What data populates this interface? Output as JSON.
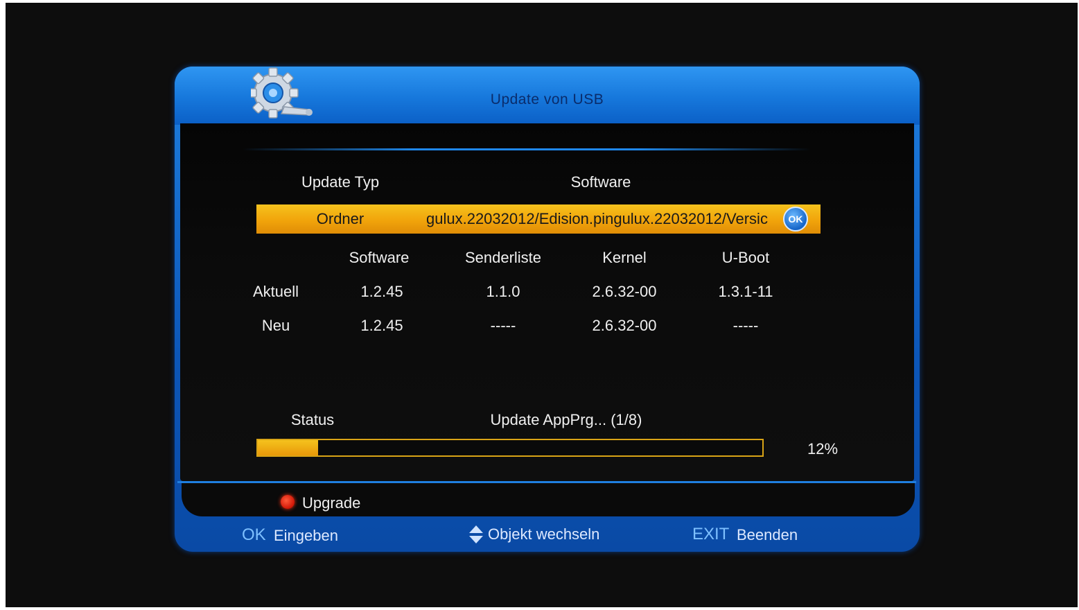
{
  "dialog": {
    "title": "Update von USB"
  },
  "selection": {
    "label_col": "Update Typ",
    "value_col": "Software",
    "row_label": "Ordner",
    "row_value": "gulux.22032012/Edision.pingulux.22032012/Versic",
    "ok_badge": "OK"
  },
  "versions": {
    "headers": [
      "Software",
      "Senderliste",
      "Kernel",
      "U-Boot"
    ],
    "rows": [
      {
        "label": "Aktuell",
        "values": [
          "1.2.45",
          "1.1.0",
          "2.6.32-00",
          "1.3.1-11"
        ]
      },
      {
        "label": "Neu",
        "values": [
          "1.2.45",
          "-----",
          "2.6.32-00",
          "-----"
        ]
      }
    ]
  },
  "status": {
    "label": "Status",
    "text": "Update AppPrg... (1/8)",
    "percent_text": "12%",
    "progress": 0.12
  },
  "actions": {
    "upgrade": "Upgrade"
  },
  "hints": {
    "ok_key": "OK",
    "ok_label": "Eingeben",
    "nav_label": "Objekt wechseln",
    "exit_key": "EXIT",
    "exit_label": "Beenden"
  },
  "colors": {
    "accent_blue": "#1677db",
    "highlight_orange": "#f1a40b",
    "record_red": "#d11606"
  },
  "icons": {
    "header": "gear-icon",
    "nav": "updown-arrows-icon"
  }
}
